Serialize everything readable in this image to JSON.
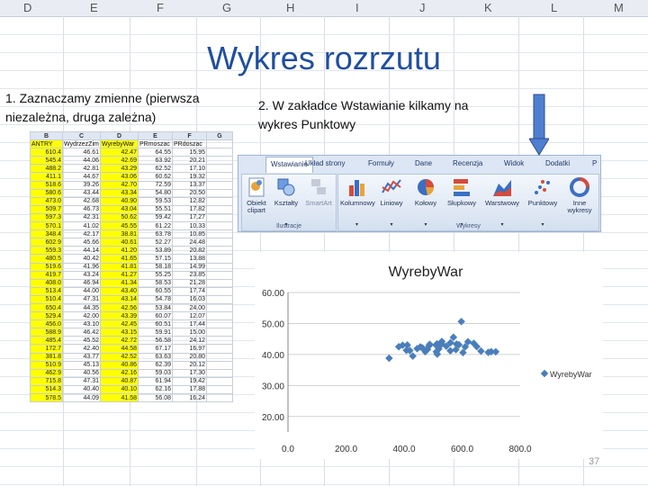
{
  "sheet_columns": [
    "D",
    "E",
    "F",
    "G",
    "H",
    "I",
    "J",
    "K",
    "L",
    "M"
  ],
  "slide": {
    "title": "Wykres rozrzutu",
    "step1_text": "1. Zaznaczamy zmienne (pierwsza niezależna, druga zależna)",
    "step2_text": "2. W zakładce Wstawianie kilkamy na wykres Punktowy",
    "page_number": "37"
  },
  "table": {
    "columns": [
      "B",
      "C",
      "D",
      "E",
      "F",
      "G"
    ],
    "header": [
      "ANTRY",
      "WydrzezZim",
      "WyrebyWar",
      "PRmoszac",
      "PRdoszac",
      ""
    ],
    "highlighted_columns": [
      0,
      2
    ],
    "rows": [
      [
        "610.4",
        "46.61",
        "42.47",
        "64.55",
        "15.95"
      ],
      [
        "545.4",
        "44.06",
        "42.69",
        "63.92",
        "20.21"
      ],
      [
        "488.2",
        "42.81",
        "43.29",
        "62.52",
        "17.10"
      ],
      [
        "411.1",
        "44.67",
        "43.06",
        "60.62",
        "19.32"
      ],
      [
        "518.6",
        "39.26",
        "42.70",
        "72.59",
        "13.37"
      ],
      [
        "580.6",
        "43.44",
        "43.34",
        "54.80",
        "20.50"
      ],
      [
        "473.0",
        "42.68",
        "40.90",
        "59.53",
        "12.82"
      ],
      [
        "509.7",
        "46.73",
        "43.04",
        "55.51",
        "17.82"
      ],
      [
        "597.3",
        "42.31",
        "50.62",
        "59.42",
        "17.27"
      ],
      [
        "570.1",
        "41.02",
        "45.55",
        "61.22",
        "10.33"
      ],
      [
        "348.4",
        "42.17",
        "38.81",
        "63.78",
        "10.85"
      ],
      [
        "602.9",
        "45.66",
        "40.61",
        "52.27",
        "24.48"
      ],
      [
        "559.3",
        "44.14",
        "41.20",
        "53.89",
        "20.82"
      ],
      [
        "480.5",
        "40.42",
        "41.65",
        "57.15",
        "13.88"
      ],
      [
        "519.6",
        "41.96",
        "41.81",
        "58.18",
        "14.99"
      ],
      [
        "419.7",
        "43.24",
        "41.27",
        "55.25",
        "23.85"
      ],
      [
        "408.0",
        "46.94",
        "41.34",
        "58.53",
        "21.28"
      ],
      [
        "513.4",
        "44.00",
        "43.40",
        "60.55",
        "17.74"
      ],
      [
        "510.4",
        "47.31",
        "43.14",
        "54.78",
        "16.03"
      ],
      [
        "650.4",
        "44.35",
        "42.56",
        "53.84",
        "24.00"
      ],
      [
        "529.4",
        "42.00",
        "43.39",
        "60.07",
        "12.07"
      ],
      [
        "456.0",
        "43.10",
        "42.45",
        "60.51",
        "17.44"
      ],
      [
        "588.9",
        "46.42",
        "43.15",
        "59.91",
        "15.00"
      ],
      [
        "485.4",
        "45.52",
        "42.72",
        "56.58",
        "24.12"
      ],
      [
        "172.7",
        "42.40",
        "44.58",
        "67.17",
        "16.97"
      ],
      [
        "381.8",
        "43.77",
        "42.52",
        "63.63",
        "20.80"
      ],
      [
        "510.9",
        "45.13",
        "40.86",
        "62.39",
        "20.12"
      ],
      [
        "462.9",
        "40.56",
        "42.16",
        "59.03",
        "17.30"
      ],
      [
        "715.8",
        "47.31",
        "40.87",
        "61.94",
        "19.42"
      ],
      [
        "514.3",
        "40.40",
        "40.10",
        "62.16",
        "17.88"
      ],
      [
        "578.5",
        "44.09",
        "41.58",
        "56.08",
        "16.24"
      ]
    ]
  },
  "ribbon": {
    "tabs": [
      "Wstawianie",
      "Układ strony",
      "Formuły",
      "Dane",
      "Recenzja",
      "Widok",
      "Dodatki",
      "P"
    ],
    "active_tab": "Wstawianie",
    "groups": [
      {
        "label": "Ilustracje",
        "buttons": [
          "Obiekt clipart",
          "Kształty",
          "SmartArt"
        ]
      },
      {
        "label": "Wykresy",
        "buttons": [
          "Kolumnowy",
          "Liniowy",
          "Kołowy",
          "Słupkowy",
          "Warstwowy",
          "Punktowy",
          "Inne wykresy"
        ]
      }
    ],
    "colors": {
      "bar": "#dce6f4",
      "active": "#ffffff"
    }
  },
  "chart_data": {
    "type": "scatter",
    "title": "WyrebyWar",
    "xlabel": "",
    "ylabel": "",
    "xlim": [
      0,
      800
    ],
    "ylim": [
      0,
      60
    ],
    "x_ticks": [
      "0.0",
      "200.0",
      "400.0",
      "600.0",
      "800.0"
    ],
    "y_ticks": [
      "20.00",
      "30.00",
      "40.00",
      "50.00",
      "60.00"
    ],
    "grid": true,
    "legend": "right",
    "color": "#4a7ebb",
    "series": [
      {
        "name": "WyrebyWar",
        "points": [
          [
            610.4,
            42.47
          ],
          [
            545.4,
            42.69
          ],
          [
            488.2,
            43.29
          ],
          [
            411.1,
            43.06
          ],
          [
            518.6,
            42.7
          ],
          [
            580.6,
            43.34
          ],
          [
            473.0,
            40.9
          ],
          [
            509.7,
            43.04
          ],
          [
            597.3,
            50.62
          ],
          [
            570.1,
            45.55
          ],
          [
            348.4,
            38.81
          ],
          [
            602.9,
            40.61
          ],
          [
            559.3,
            41.2
          ],
          [
            480.5,
            41.65
          ],
          [
            519.6,
            41.81
          ],
          [
            419.7,
            41.27
          ],
          [
            408.0,
            41.34
          ],
          [
            513.4,
            43.4
          ],
          [
            510.4,
            43.14
          ],
          [
            650.4,
            42.56
          ],
          [
            529.4,
            43.39
          ],
          [
            456.0,
            42.45
          ],
          [
            588.9,
            43.15
          ],
          [
            485.4,
            42.72
          ],
          [
            381.8,
            42.52
          ],
          [
            510.9,
            40.86
          ],
          [
            462.9,
            42.16
          ],
          [
            715.8,
            40.87
          ],
          [
            514.3,
            40.1
          ],
          [
            578.5,
            41.58
          ],
          [
            395.0,
            43.0
          ],
          [
            430.0,
            39.5
          ],
          [
            445.0,
            41.9
          ],
          [
            530.0,
            44.2
          ],
          [
            560.0,
            43.8
          ],
          [
            620.0,
            44.1
          ],
          [
            640.0,
            43.6
          ],
          [
            690.0,
            40.7
          ],
          [
            700.0,
            40.9
          ],
          [
            665.0,
            41.1
          ]
        ]
      }
    ]
  }
}
